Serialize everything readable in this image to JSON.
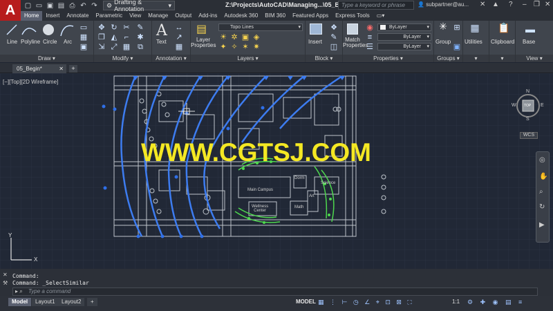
{
  "app": {
    "logo_letter": "A"
  },
  "workspace": {
    "label": "Drafting & Annotation"
  },
  "title": "Z:\\Projects\\AutoCAD\\Managing...\\05_Begin.dwg",
  "search": {
    "placeholder": "Type a keyword or phrase"
  },
  "user": {
    "name": "subpartner@au..."
  },
  "tabs": [
    "Home",
    "Insert",
    "Annotate",
    "Parametric",
    "View",
    "Manage",
    "Output",
    "Add-ins",
    "Autodesk 360",
    "BIM 360",
    "Featured Apps",
    "Express Tools"
  ],
  "ribbon": {
    "draw": {
      "label": "Draw",
      "tools": [
        "Line",
        "Polyline",
        "Circle",
        "Arc"
      ]
    },
    "modify": {
      "label": "Modify"
    },
    "annotation": {
      "label": "Annotation",
      "text": "Text"
    },
    "layers": {
      "label": "Layers",
      "layer_properties": "Layer\nProperties",
      "layer_dropdown": "Topo Lines"
    },
    "block": {
      "label": "Block",
      "insert": "Insert"
    },
    "properties": {
      "label": "Properties",
      "match": "Match\nProperties",
      "color": "ByLayer",
      "linetype": "ByLayer",
      "lineweight": "ByLayer"
    },
    "groups": {
      "label": "Groups",
      "group": "Group"
    },
    "utilities": {
      "label": "Utilities"
    },
    "clipboard": {
      "label": "Clipboard"
    },
    "base": {
      "label": "Base"
    },
    "view": {
      "label": "View"
    }
  },
  "file_tab": {
    "name": "05_Begin*"
  },
  "viewport": {
    "label": "[−][Top][2D Wireframe]",
    "labels": [
      "Main Campus",
      "Dorm",
      "Science",
      "Art",
      "Wellness\nCenter",
      "Math"
    ],
    "viewcube": {
      "top": "TOP",
      "n": "N",
      "s": "S",
      "e": "E",
      "w": "W"
    },
    "wcs": "WCS",
    "axis_x": "X",
    "axis_y": "Y"
  },
  "watermark": "WWW.CGTSJ.COM",
  "command": {
    "history": [
      "Command:",
      "Command:  _SelectSimilar"
    ],
    "placeholder": "Type a command"
  },
  "layout_tabs": [
    "Model",
    "Layout1",
    "Layout2"
  ],
  "status": {
    "model": "MODEL",
    "scale": "1:1"
  },
  "colors": {
    "accent": "#1f5fd6",
    "curves": "#3d7cf0",
    "trees": "#4ed84e",
    "watermark": "#f4e823",
    "logo": "#b71c1c"
  }
}
